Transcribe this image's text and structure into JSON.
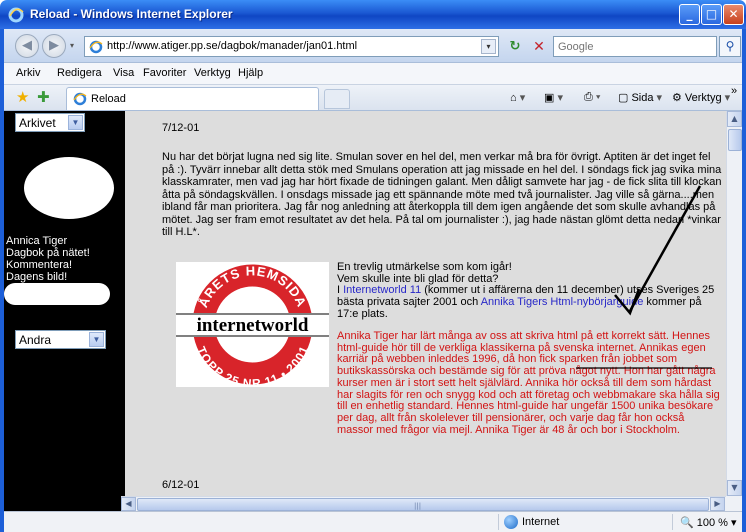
{
  "window": {
    "title": "Reload - Windows Internet Explorer",
    "minimize": "_",
    "maximize": "□",
    "close": "✕"
  },
  "toolbar": {
    "back_icon": "◀",
    "forward_icon": "▶",
    "dropdown_icon": "▾",
    "url": "http://www.atiger.pp.se/dagbok/manader/jan01.html",
    "refresh_icon": "↻",
    "stop_icon": "✕",
    "search_placeholder": "Google",
    "search_icon": "⚲"
  },
  "menu": {
    "items": [
      "Arkiv",
      "Redigera",
      "Visa",
      "Favoriter",
      "Verktyg",
      "Hjälp"
    ]
  },
  "tabs": {
    "active_label": "Reload",
    "commands": {
      "page": "Sida",
      "tools": "Verktyg",
      "more": "»"
    }
  },
  "sidebar": {
    "archive_select": "Arkivet",
    "links": [
      "Annica Tiger",
      "Dagbok på nätet!",
      "Kommentera!",
      "Dagens bild!"
    ],
    "other_select": "Andra"
  },
  "content": {
    "date1": "7/12-01",
    "paragraph": "Nu har det börjat lugna ned sig lite. Smulan sover en hel del, men verkar må bra för övrigt. Aptiten är det inget fel på :). Tyvärr innebar allt detta stök med Smulans operation att jag missade en hel del. I söndags fick jag svika mina klasskamrater, men vad jag har hört fixade de tidningen galant. Men dåligt samvete har jag - de fick slita till klockan åtta på söndagskvällen. I onsdags missade jag ett spännande möte med två journalister. Jag ville så gärna....men ibland får man prioritera. Jag får nog anledning att återkoppla till dem igen angående det som skulle avhandlas på mötet. Jag ser fram emot resultatet av det hela. På tal om journalister :), jag hade nästan glömt detta nedan *vinkar till H.L*.",
    "award_logo": {
      "top_arc": "ÅRETS HEMSIDA",
      "center": "internetworld",
      "bottom_arc": "TOPP 25 NR 11 • 2001"
    },
    "award_line1": "En trevlig utmärkelse som kom igår!",
    "award_line2": "Vem skulle inte bli glad för detta?",
    "award_line3_pre": "I ",
    "award_link1": "Internetworld 11",
    "award_line3_mid": " (kommer ut i affärerna den 11 december) utses Sveriges 25 bästa privata sajter 2001 och ",
    "award_link2": "Annika Tigers Html-nybörjarguide",
    "award_line3_post": " kommer på 17:e plats.",
    "red_text": "Annika Tiger har lärt många av oss att skriva html på ett korrekt sätt. Hennes html-guide hör till de verkliga klassikerna på svenska internet. Annikas egen karriär på webben inleddes 1996, då hon fick sparken från jobbet som butikskassörska och bestämde sig för att pröva något nytt. Hon har gått några kurser men är i stort sett helt självlärd. Annika hör också till dem som hårdast har slagits för ren och snygg kod och att företag och webbmakare ska hålla sig till en enhetlig standard. Hennes html-guide har ungefär 1500 unika besökare per dag, allt från skolelever till pensionärer, och varje dag får hon också massor med frågor via mejl. Annika Tiger är 48 år och bor i Stockholm.",
    "date2": "6/12-01"
  },
  "status": {
    "zone": "Internet",
    "zoom": "100 %"
  },
  "colors": {
    "titlebar": "#1a58d2",
    "link": "#2828c8",
    "red_text": "#d21414",
    "content_bg": "#dddddd",
    "sidebar_bg": "#000000",
    "logo_red": "#d8242a"
  }
}
